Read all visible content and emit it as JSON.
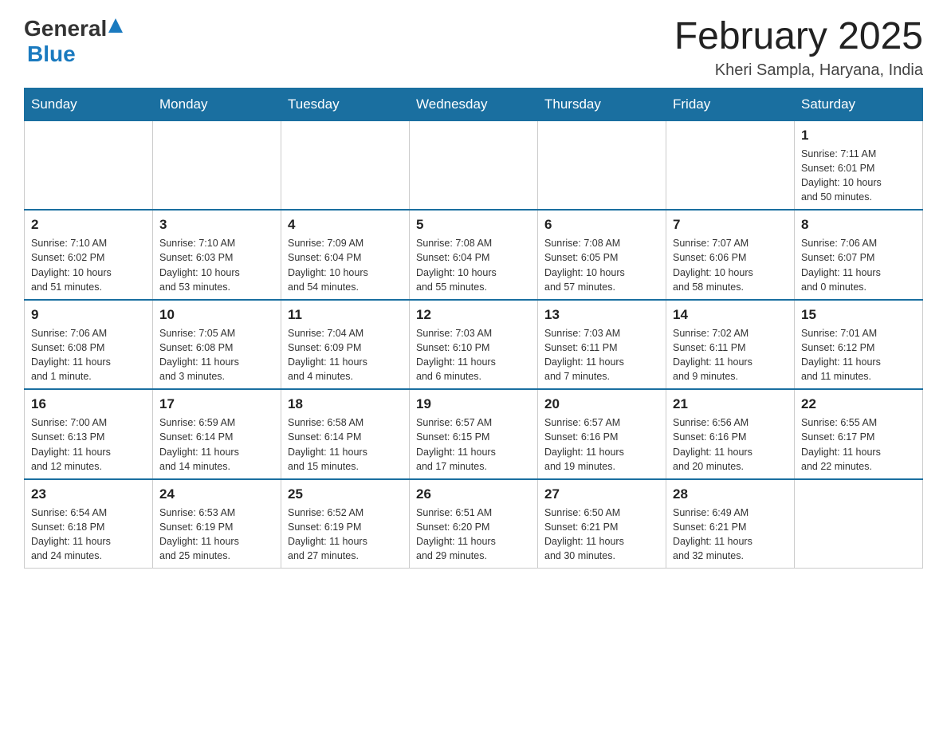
{
  "header": {
    "logo_general": "General",
    "logo_blue": "Blue",
    "month_title": "February 2025",
    "location": "Kheri Sampla, Haryana, India"
  },
  "days_of_week": [
    "Sunday",
    "Monday",
    "Tuesday",
    "Wednesday",
    "Thursday",
    "Friday",
    "Saturday"
  ],
  "weeks": [
    [
      {
        "day": "",
        "info": ""
      },
      {
        "day": "",
        "info": ""
      },
      {
        "day": "",
        "info": ""
      },
      {
        "day": "",
        "info": ""
      },
      {
        "day": "",
        "info": ""
      },
      {
        "day": "",
        "info": ""
      },
      {
        "day": "1",
        "info": "Sunrise: 7:11 AM\nSunset: 6:01 PM\nDaylight: 10 hours\nand 50 minutes."
      }
    ],
    [
      {
        "day": "2",
        "info": "Sunrise: 7:10 AM\nSunset: 6:02 PM\nDaylight: 10 hours\nand 51 minutes."
      },
      {
        "day": "3",
        "info": "Sunrise: 7:10 AM\nSunset: 6:03 PM\nDaylight: 10 hours\nand 53 minutes."
      },
      {
        "day": "4",
        "info": "Sunrise: 7:09 AM\nSunset: 6:04 PM\nDaylight: 10 hours\nand 54 minutes."
      },
      {
        "day": "5",
        "info": "Sunrise: 7:08 AM\nSunset: 6:04 PM\nDaylight: 10 hours\nand 55 minutes."
      },
      {
        "day": "6",
        "info": "Sunrise: 7:08 AM\nSunset: 6:05 PM\nDaylight: 10 hours\nand 57 minutes."
      },
      {
        "day": "7",
        "info": "Sunrise: 7:07 AM\nSunset: 6:06 PM\nDaylight: 10 hours\nand 58 minutes."
      },
      {
        "day": "8",
        "info": "Sunrise: 7:06 AM\nSunset: 6:07 PM\nDaylight: 11 hours\nand 0 minutes."
      }
    ],
    [
      {
        "day": "9",
        "info": "Sunrise: 7:06 AM\nSunset: 6:08 PM\nDaylight: 11 hours\nand 1 minute."
      },
      {
        "day": "10",
        "info": "Sunrise: 7:05 AM\nSunset: 6:08 PM\nDaylight: 11 hours\nand 3 minutes."
      },
      {
        "day": "11",
        "info": "Sunrise: 7:04 AM\nSunset: 6:09 PM\nDaylight: 11 hours\nand 4 minutes."
      },
      {
        "day": "12",
        "info": "Sunrise: 7:03 AM\nSunset: 6:10 PM\nDaylight: 11 hours\nand 6 minutes."
      },
      {
        "day": "13",
        "info": "Sunrise: 7:03 AM\nSunset: 6:11 PM\nDaylight: 11 hours\nand 7 minutes."
      },
      {
        "day": "14",
        "info": "Sunrise: 7:02 AM\nSunset: 6:11 PM\nDaylight: 11 hours\nand 9 minutes."
      },
      {
        "day": "15",
        "info": "Sunrise: 7:01 AM\nSunset: 6:12 PM\nDaylight: 11 hours\nand 11 minutes."
      }
    ],
    [
      {
        "day": "16",
        "info": "Sunrise: 7:00 AM\nSunset: 6:13 PM\nDaylight: 11 hours\nand 12 minutes."
      },
      {
        "day": "17",
        "info": "Sunrise: 6:59 AM\nSunset: 6:14 PM\nDaylight: 11 hours\nand 14 minutes."
      },
      {
        "day": "18",
        "info": "Sunrise: 6:58 AM\nSunset: 6:14 PM\nDaylight: 11 hours\nand 15 minutes."
      },
      {
        "day": "19",
        "info": "Sunrise: 6:57 AM\nSunset: 6:15 PM\nDaylight: 11 hours\nand 17 minutes."
      },
      {
        "day": "20",
        "info": "Sunrise: 6:57 AM\nSunset: 6:16 PM\nDaylight: 11 hours\nand 19 minutes."
      },
      {
        "day": "21",
        "info": "Sunrise: 6:56 AM\nSunset: 6:16 PM\nDaylight: 11 hours\nand 20 minutes."
      },
      {
        "day": "22",
        "info": "Sunrise: 6:55 AM\nSunset: 6:17 PM\nDaylight: 11 hours\nand 22 minutes."
      }
    ],
    [
      {
        "day": "23",
        "info": "Sunrise: 6:54 AM\nSunset: 6:18 PM\nDaylight: 11 hours\nand 24 minutes."
      },
      {
        "day": "24",
        "info": "Sunrise: 6:53 AM\nSunset: 6:19 PM\nDaylight: 11 hours\nand 25 minutes."
      },
      {
        "day": "25",
        "info": "Sunrise: 6:52 AM\nSunset: 6:19 PM\nDaylight: 11 hours\nand 27 minutes."
      },
      {
        "day": "26",
        "info": "Sunrise: 6:51 AM\nSunset: 6:20 PM\nDaylight: 11 hours\nand 29 minutes."
      },
      {
        "day": "27",
        "info": "Sunrise: 6:50 AM\nSunset: 6:21 PM\nDaylight: 11 hours\nand 30 minutes."
      },
      {
        "day": "28",
        "info": "Sunrise: 6:49 AM\nSunset: 6:21 PM\nDaylight: 11 hours\nand 32 minutes."
      },
      {
        "day": "",
        "info": ""
      }
    ]
  ]
}
